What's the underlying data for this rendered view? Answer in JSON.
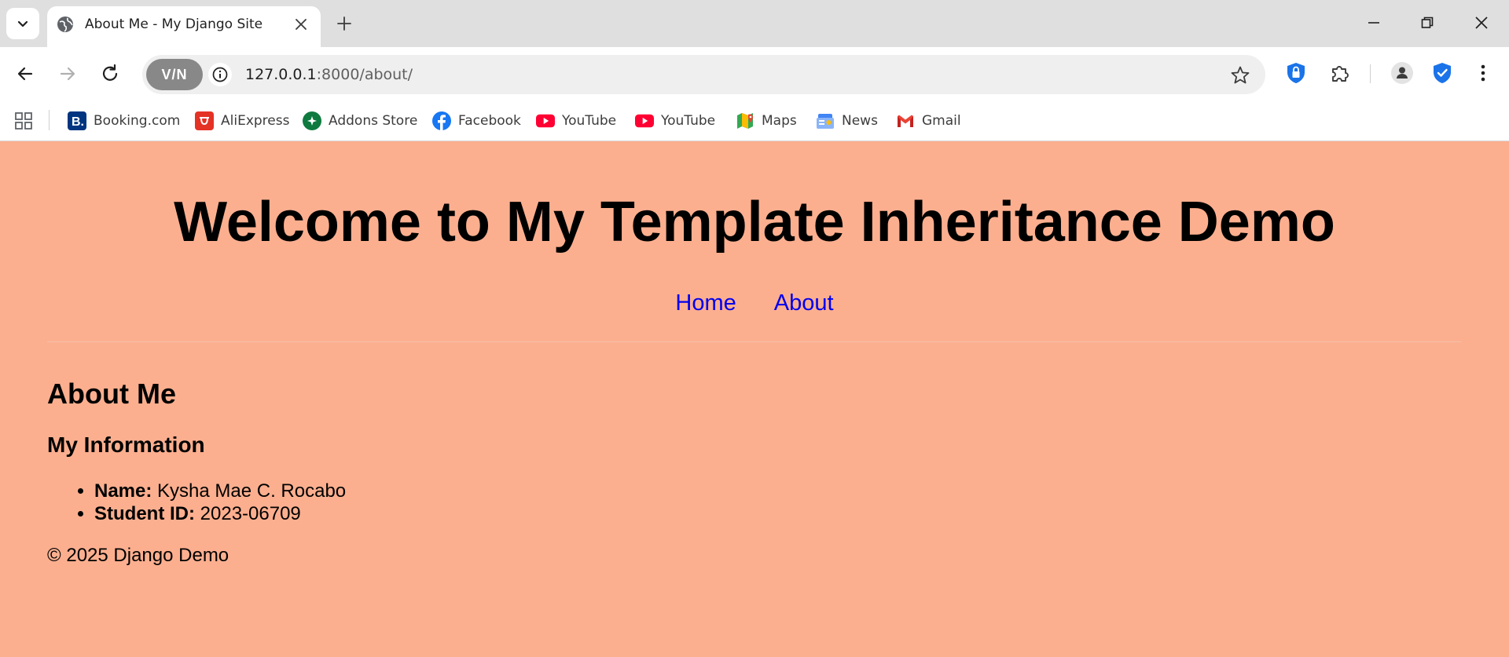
{
  "browser": {
    "tab": {
      "title": "About Me - My Django Site"
    },
    "address": {
      "host": "127.0.0.1",
      "rest": ":8000/about/"
    },
    "vpn_label": "V/N",
    "bookmarks": [
      {
        "label": "Booking.com",
        "icon": "booking-icon",
        "color": "#003580"
      },
      {
        "label": "AliExpress",
        "icon": "aliexpress-icon",
        "color": "#e43225"
      },
      {
        "label": "Addons Store",
        "icon": "addons-store-icon",
        "color": "#0e7a3f"
      },
      {
        "label": "Facebook",
        "icon": "facebook-icon",
        "color": "#1877f2"
      },
      {
        "label": "YouTube",
        "icon": "youtube-icon",
        "color": "#ff0033"
      },
      {
        "label": "YouTube",
        "icon": "youtube-icon",
        "color": "#ff0033"
      },
      {
        "label": "Maps",
        "icon": "maps-icon",
        "color": "#34a853"
      },
      {
        "label": "News",
        "icon": "news-icon",
        "color": "#4285f4"
      },
      {
        "label": "Gmail",
        "icon": "gmail-icon",
        "color": "#ea4335"
      }
    ]
  },
  "page": {
    "background": "#fcaf8f",
    "site_title": "Welcome to My Template Inheritance Demo",
    "nav": {
      "home": "Home",
      "about": "About"
    },
    "heading": "About Me",
    "subheading": "My Information",
    "info": [
      {
        "label": "Name:",
        "value": " Kysha Mae C. Rocabo"
      },
      {
        "label": "Student ID:",
        "value": " 2023-06709"
      }
    ],
    "footer": "© 2025 Django Demo"
  }
}
